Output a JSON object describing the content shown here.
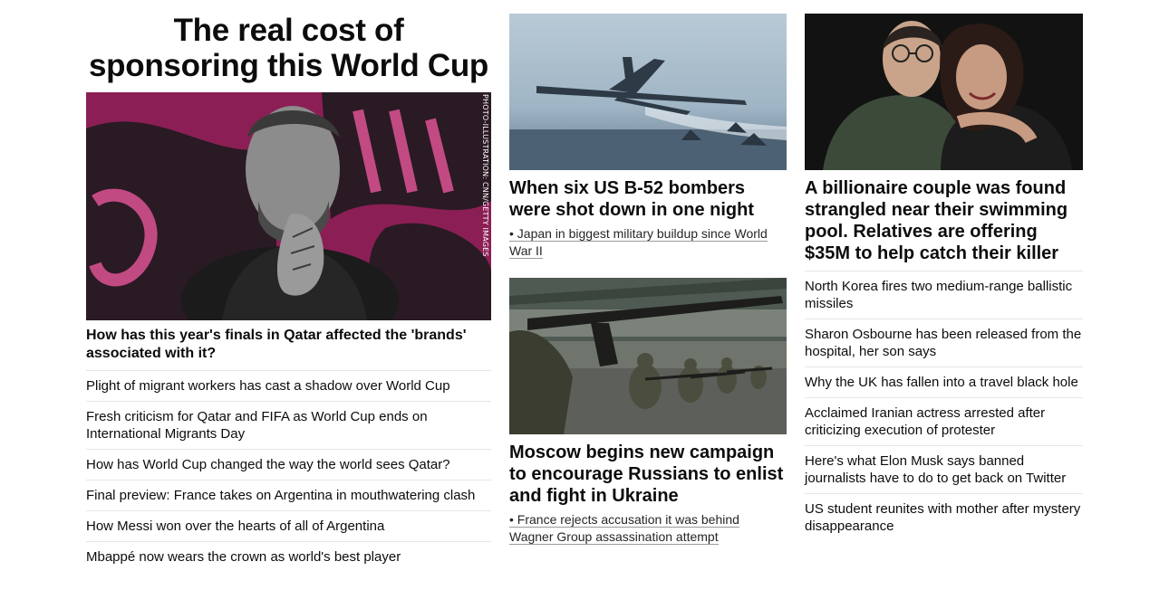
{
  "left": {
    "title": "The real cost of sponsoring this World Cup",
    "photo_credit": "PHOTO-ILLUSTRATION: CNN/GETTY IMAGES",
    "subheadline": "How has this year's finals in Qatar affected the 'brands' associated with it?",
    "links": [
      "Plight of migrant workers has cast a shadow over World Cup",
      "Fresh criticism for Qatar and FIFA as World Cup ends on International Migrants Day",
      "How has World Cup changed the way the world sees Qatar?",
      "Final preview: France takes on Argentina in mouthwatering clash",
      "How Messi won over the hearts of all of Argentina",
      "Mbappé now wears the crown as world's best player"
    ]
  },
  "middle": {
    "story1": {
      "headline": "When six US B-52 bombers were shot down in one night",
      "related": "• Japan in biggest military buildup since World War II"
    },
    "story2": {
      "headline": "Moscow begins new campaign to encourage Russians to enlist and fight in Ukraine",
      "related": "• France rejects accusation it was behind Wagner Group assassination attempt"
    }
  },
  "right": {
    "headline": "A billionaire couple was found strangled near their swimming pool. Relatives are offering $35M to help catch their killer",
    "links": [
      "North Korea fires two medium-range ballistic missiles",
      "Sharon Osbourne has been released from the hospital, her son says",
      "Why the UK has fallen into a travel black hole",
      "Acclaimed Iranian actress arrested after criticizing execution of protester",
      "Here's what Elon Musk says banned journalists have to do to get back on Twitter",
      "US student reunites with mother after mystery disappearance"
    ]
  }
}
